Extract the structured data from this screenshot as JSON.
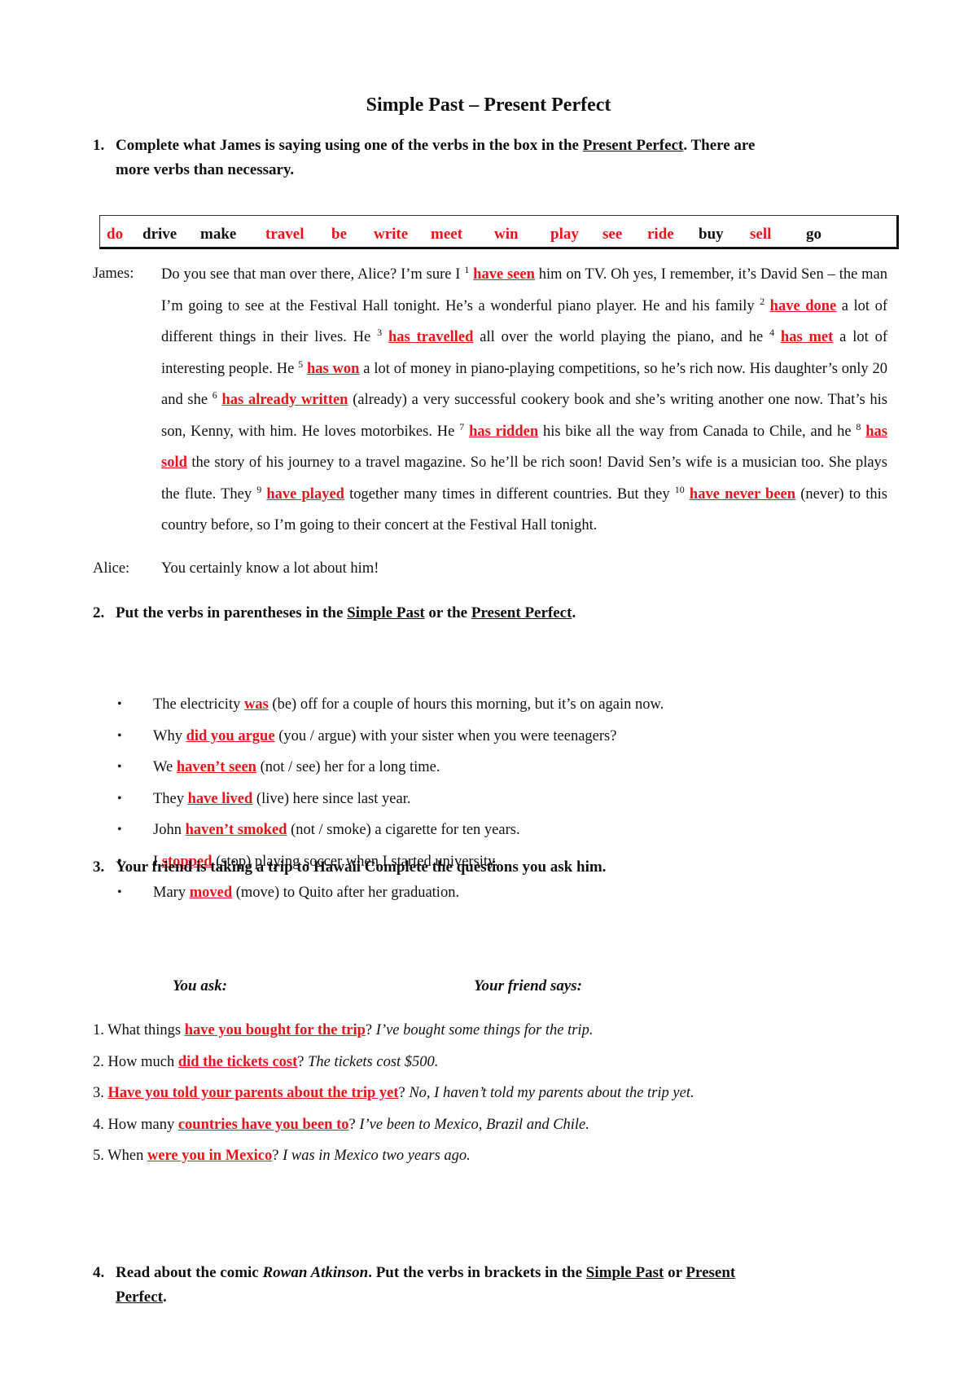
{
  "title": "Simple Past – Present Perfect",
  "q1": {
    "number": "1.",
    "text_before": "Complete what James is saying using one of the verbs in the box in the ",
    "text_underlined": "Present Perfect",
    "text_after": ". There are",
    "line2": "more verbs than necessary.",
    "verbs": [
      {
        "word": "do",
        "used": true
      },
      {
        "word": "drive",
        "used": false
      },
      {
        "word": "make",
        "used": false
      },
      {
        "word": "travel",
        "used": true
      },
      {
        "word": "be",
        "used": true
      },
      {
        "word": "write",
        "used": true
      },
      {
        "word": "meet",
        "used": true
      },
      {
        "word": "win",
        "used": true
      },
      {
        "word": "play",
        "used": true
      },
      {
        "word": "see",
        "used": true
      },
      {
        "word": "ride",
        "used": true
      },
      {
        "word": "buy",
        "used": false
      },
      {
        "word": "sell",
        "used": true
      },
      {
        "word": "go",
        "used": false
      }
    ],
    "colors": {
      "used": "#e8141b",
      "unused": "#111111"
    },
    "speaker_james": "James:",
    "speaker_alice": "Alice:",
    "alice_line": "You certainly know a lot about him!",
    "segments": [
      {
        "t": "Do you see that man over there, Alice? I’m sure I "
      },
      {
        "sup": "1"
      },
      {
        "ans": "have seen"
      },
      {
        "t": " him on TV. Oh yes, I remember, it’s David Sen – the man I’m going to see at the Festival Hall tonight. He’s a wonderful piano player. He and his family "
      },
      {
        "sup": "2"
      },
      {
        "ans": "have done"
      },
      {
        "t": " a lot of different things in their lives. He "
      },
      {
        "sup": "3"
      },
      {
        "ans": "has travelled"
      },
      {
        "t": " all over the world playing the piano, and he "
      },
      {
        "sup": "4"
      },
      {
        "ans": "has met"
      },
      {
        "t": " a lot of interesting people. He "
      },
      {
        "sup": "5"
      },
      {
        "ans": "has won"
      },
      {
        "t": " a lot of money in piano-playing competitions, so he’s rich now. His daughter’s only 20 and she "
      },
      {
        "sup": "6"
      },
      {
        "ans": "has already written"
      },
      {
        "t": " (already) a very successful cookery book and she’s writing another one now. That’s his son, Kenny, with him. He loves motorbikes. He "
      },
      {
        "sup": "7"
      },
      {
        "ans": "has ridden"
      },
      {
        "t": " his bike all the way from Canada to Chile, and he "
      },
      {
        "sup": "8"
      },
      {
        "ans": "has sold"
      },
      {
        "t": " the story of his journey to a travel magazine. So he’ll be rich soon! David Sen’s wife is a musician too. She plays the flute. They "
      },
      {
        "sup": "9"
      },
      {
        "ans": "have played"
      },
      {
        "t": " together many times in different countries. But they "
      },
      {
        "sup": "10"
      },
      {
        "ans": "have never been"
      },
      {
        "t": " (never) to this country before, so I’m going to their concert at the Festival Hall tonight."
      }
    ]
  },
  "q2": {
    "number": "2.",
    "text_before": "Put the verbs in parentheses in the ",
    "ul1": "Simple Past",
    "mid": " or the ",
    "ul2": "Present Perfect",
    "end": ".",
    "items": [
      {
        "pre": "The electricity ",
        "ans": "was",
        "post": " (be) off for a couple of hours this morning, but it’s on again now."
      },
      {
        "pre": "Why ",
        "ans": "did you argue",
        "post": " (you / argue) with your sister when you were teenagers?"
      },
      {
        "pre": "We ",
        "ans": "haven’t seen",
        "post": " (not / see) her for a long time."
      },
      {
        "pre": "They ",
        "ans": "have lived",
        "post": " (live) here since last year."
      },
      {
        "pre": "John ",
        "ans": "haven’t smoked",
        "post": " (not / smoke) a cigarette for ten years."
      },
      {
        "pre": "I ",
        "ans": "stopped",
        "post": " (stop) playing soccer when I started university."
      },
      {
        "pre": "Mary ",
        "ans": "moved",
        "post": " (move) to Quito after her graduation."
      }
    ]
  },
  "q3": {
    "number": "3.",
    "text": "Your friend is taking a trip to Hawaii Complete the questions you ask him.",
    "col_you_ask": "You ask:",
    "col_friend_says": "Your friend says:",
    "items": [
      {
        "pre": "1. What things ",
        "ans": "have you bought for the trip",
        "q": "? ",
        "reply": "I’ve bought some things for the trip."
      },
      {
        "pre": "2. How much ",
        "ans": "did the tickets cost",
        "q": "? ",
        "reply": "The tickets cost $500."
      },
      {
        "pre": "3. ",
        "ans": "Have you told your parents about the trip yet",
        "q": "? ",
        "reply": "No, I haven’t told my parents about the trip yet."
      },
      {
        "pre": "4. How many ",
        "ans": "countries have you been to",
        "q": "? ",
        "reply": "I’ve been to Mexico, Brazil and Chile."
      },
      {
        "pre": "5. When ",
        "ans": "were you in Mexico",
        "q": "? ",
        "reply": "I was in Mexico two years ago."
      }
    ]
  },
  "q4": {
    "number": "4.",
    "pre": "Read about the comic ",
    "italic": "Rowan Atkinson",
    "mid": ". Put the verbs in brackets in the ",
    "ul1": "Simple Past",
    "or": " or ",
    "ul2a": "Present",
    "ul2b": "Perfect",
    "end": "."
  }
}
